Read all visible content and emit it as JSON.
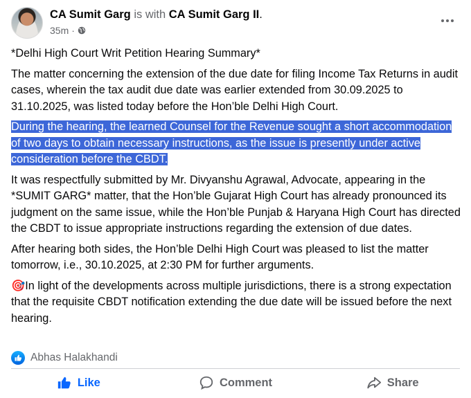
{
  "post": {
    "author": "CA Sumit Garg",
    "with_text": "is with",
    "tagged": "CA Sumit Garg II",
    "tagged_suffix": ".",
    "time": "35m",
    "audience_icon": "globe-icon",
    "more_icon": "more-options-icon"
  },
  "body": {
    "title": "*Delhi High Court Writ Petition Hearing Summary*",
    "para1": "The matter concerning the extension of the due date for filing Income Tax Returns in audit cases, wherein the tax audit due date was earlier extended from 30.09.2025 to 31.10.2025, was listed today before the Hon’ble Delhi High Court.",
    "para2_highlighted": "During the hearing, the learned Counsel for the Revenue sought a short accommodation of two days to obtain necessary instructions, as the issue is presently under active consideration before the CBDT.",
    "para3": "It was respectfully submitted by Mr. Divyanshu Agrawal, Advocate, appearing in the *SUMIT GARG* matter, that the Hon’ble Gujarat High Court has already pronounced its judgment on the same issue, while the Hon’ble Punjab & Haryana High Court has directed the CBDT to issue appropriate instructions regarding the extension of due dates.",
    "para4": "After hearing both sides, the Hon’ble Delhi High Court was pleased to list the matter tomorrow, i.e., 30.10.2025, at 2:30 PM for further arguments.",
    "para5_emoji": "🎯",
    "para5": "In light of the developments across multiple jurisdictions, there is a strong expectation that the requisite CBDT notification extending the due date will be issued before the next hearing."
  },
  "reactions": {
    "icon": "like-reaction-icon",
    "names": "Abhas Halakhandi"
  },
  "actions": {
    "like_label": "Like",
    "comment_label": "Comment",
    "share_label": "Share"
  },
  "colors": {
    "like_blue": "#0866ff",
    "highlight": "#3d67d8",
    "secondary_text": "#65676b"
  }
}
